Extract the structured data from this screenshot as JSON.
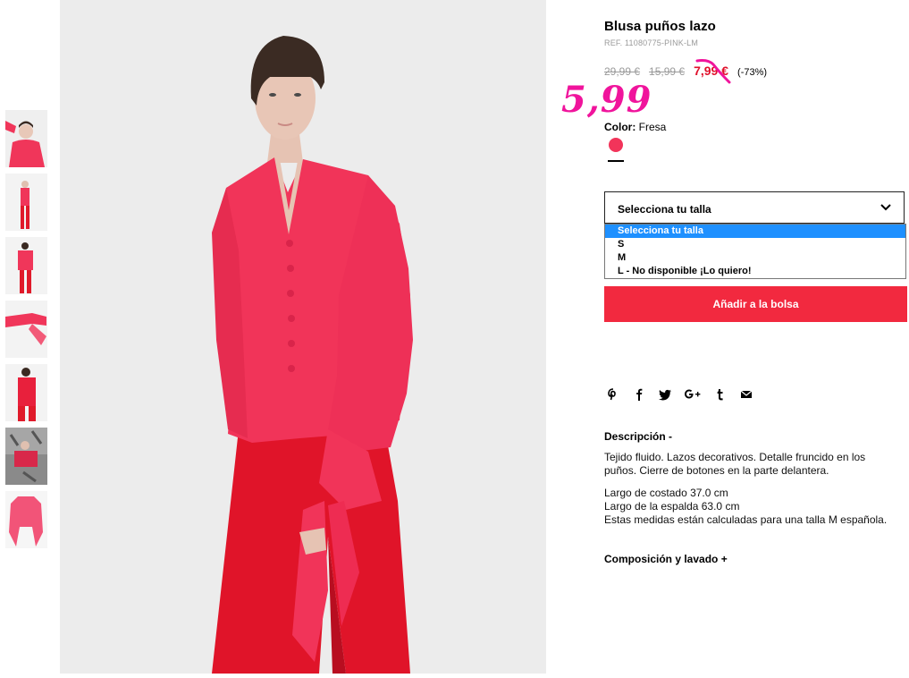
{
  "product": {
    "title": "Blusa puños lazo",
    "ref": "REF. 11080775-PINK-LM",
    "prices": {
      "original": "29,99 €",
      "previous": "15,99 €",
      "current": "7,99 €",
      "discount": "(-73%)"
    },
    "annotation_price": "5,99",
    "color_label": "Color:",
    "color_value": "Fresa",
    "swatch_color": "#f2345a"
  },
  "size_select": {
    "label": "Selecciona tu talla",
    "options": [
      "Selecciona tu talla",
      "S",
      "M",
      "L - No disponible ¡Lo quiero!"
    ],
    "highlighted": "Selecciona tu talla"
  },
  "add_to_bag": "Añadir a la bolsa",
  "share_icons": [
    "pinterest-icon",
    "facebook-icon",
    "twitter-icon",
    "google-plus-icon",
    "tumblr-icon",
    "email-icon"
  ],
  "description": {
    "heading": "Descripción -",
    "paragraph1": "Tejido fluido. Lazos decorativos. Detalle fruncido en los puños. Cierre de botones en la parte delantera.",
    "measure1": "Largo de costado 37.0 cm",
    "measure2": "Largo de la espalda 63.0 cm",
    "measure3": "Estas medidas están calculadas para una talla M española."
  },
  "composition_heading": "Composición y lavado +",
  "colors": {
    "accent_red": "#f2293f",
    "price_red": "#e0102b",
    "annotation_pink": "#f0149c",
    "select_blue": "#1e90ff"
  }
}
